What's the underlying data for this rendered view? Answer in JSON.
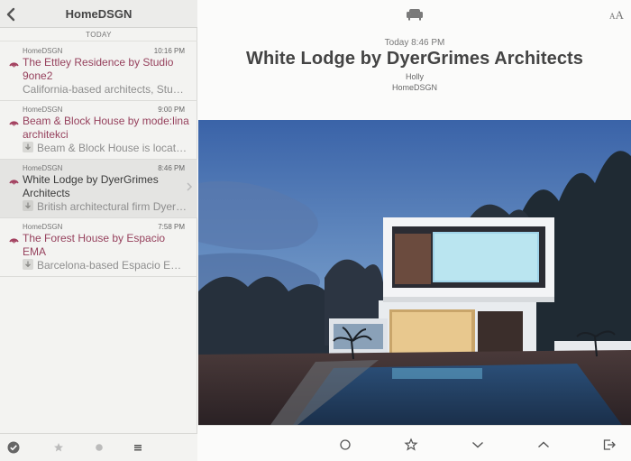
{
  "sidebar": {
    "title": "HomeDSGN",
    "section_label": "TODAY",
    "items": [
      {
        "source": "HomeDSGN",
        "time": "10:16 PM",
        "title": "The Ettley Residence by Studio 9one2",
        "snippet": "California-based architects, Stu…",
        "has_download_icon": false
      },
      {
        "source": "HomeDSGN",
        "time": "9:00 PM",
        "title": "Beam & Block House by mode:lina architekci",
        "snippet": "Beam & Block House is locat…",
        "has_download_icon": true
      },
      {
        "source": "HomeDSGN",
        "time": "8:46 PM",
        "title": "White Lodge by DyerGrimes Architects",
        "snippet": "British architectural firm Dyer…",
        "has_download_icon": true,
        "selected": true
      },
      {
        "source": "HomeDSGN",
        "time": "7:58 PM",
        "title": "The Forest House by Espacio EMA",
        "snippet": "Barcelona-based Espacio EM…",
        "has_download_icon": true
      }
    ]
  },
  "article": {
    "date": "Today 8:46 PM",
    "headline": "White Lodge by DyerGrimes Architects",
    "author": "Holly",
    "feed": "HomeDSGN",
    "text_size_glyph": "AA"
  },
  "icons": {
    "back": "chevron-left-icon",
    "readability": "armchair-icon",
    "text_size": "text-size-icon",
    "mark_all_read": "checkmark-circle-icon",
    "starred_filter": "star-icon",
    "unread_filter": "dot-icon",
    "all_filter": "list-icon",
    "mark_unread": "circle-icon",
    "star": "star-outline-icon",
    "next": "chevron-down-icon",
    "previous": "chevron-up-icon",
    "share": "share-out-icon",
    "rss": "rss-icon",
    "download": "download-icon"
  },
  "colors": {
    "unread_title": "#96415d",
    "read_title": "#3a3a3a",
    "sidebar_bg": "#f3f3f1",
    "selected_bg": "#e4e4e2"
  }
}
